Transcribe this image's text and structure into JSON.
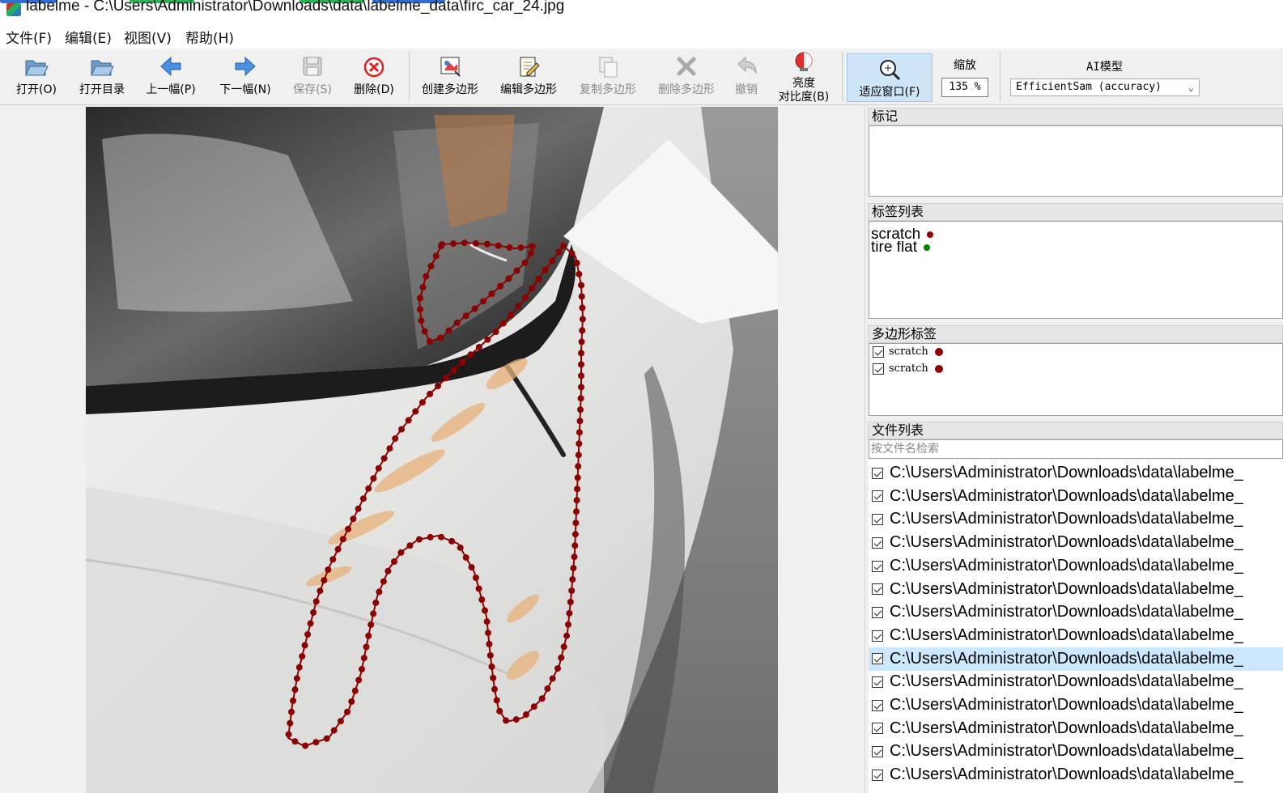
{
  "window": {
    "title": "labelme - C:\\Users\\Administrator\\Downloads\\data\\labelme_data\\firc_car_24.jpg"
  },
  "menu": [
    "文件(F)",
    "编辑(E)",
    "视图(V)",
    "帮助(H)"
  ],
  "toolbar": {
    "open": "打开(O)",
    "open_dir": "打开目录",
    "prev": "上一幅(P)",
    "next": "下一幅(N)",
    "save": "保存(S)",
    "delete": "删除(D)",
    "create_polygon": "创建多边形",
    "edit_polygon": "编辑多边形",
    "copy_polygon": "复制多边形",
    "delete_polygon": "删除多边形",
    "undo": "撤销",
    "brightness_line1": "亮度",
    "brightness_line2": "对比度(B)",
    "fit_window": "适应窗口(F)",
    "zoom_label": "缩放",
    "zoom_value": "135 %",
    "ai_label": "AI模型",
    "ai_model": "EfficientSam (accuracy)"
  },
  "docks": {
    "flags_title": "标记",
    "labels_title": "标签列表",
    "polygons_title": "多边形标签",
    "files_title": "文件列表",
    "file_search_placeholder": "按文件名检索"
  },
  "label_list": [
    {
      "name": "scratch",
      "color": "#8b0000"
    },
    {
      "name": "tire flat",
      "color": "#008000"
    }
  ],
  "polygon_labels": [
    {
      "name": "scratch",
      "color": "#8b0000",
      "checked": true
    },
    {
      "name": "scratch",
      "color": "#8b0000",
      "checked": true
    }
  ],
  "files": [
    {
      "path": "C:\\Users\\Administrator\\Downloads\\data\\labelme_",
      "checked": true,
      "selected": false
    },
    {
      "path": "C:\\Users\\Administrator\\Downloads\\data\\labelme_",
      "checked": true,
      "selected": false
    },
    {
      "path": "C:\\Users\\Administrator\\Downloads\\data\\labelme_",
      "checked": true,
      "selected": false
    },
    {
      "path": "C:\\Users\\Administrator\\Downloads\\data\\labelme_",
      "checked": true,
      "selected": false
    },
    {
      "path": "C:\\Users\\Administrator\\Downloads\\data\\labelme_",
      "checked": true,
      "selected": false
    },
    {
      "path": "C:\\Users\\Administrator\\Downloads\\data\\labelme_",
      "checked": true,
      "selected": false
    },
    {
      "path": "C:\\Users\\Administrator\\Downloads\\data\\labelme_",
      "checked": true,
      "selected": false
    },
    {
      "path": "C:\\Users\\Administrator\\Downloads\\data\\labelme_",
      "checked": true,
      "selected": false
    },
    {
      "path": "C:\\Users\\Administrator\\Downloads\\data\\labelme_",
      "checked": true,
      "selected": true
    },
    {
      "path": "C:\\Users\\Administrator\\Downloads\\data\\labelme_",
      "checked": true,
      "selected": false
    },
    {
      "path": "C:\\Users\\Administrator\\Downloads\\data\\labelme_",
      "checked": true,
      "selected": false
    },
    {
      "path": "C:\\Users\\Administrator\\Downloads\\data\\labelme_",
      "checked": true,
      "selected": false
    },
    {
      "path": "C:\\Users\\Administrator\\Downloads\\data\\labelme_",
      "checked": true,
      "selected": false
    },
    {
      "path": "C:\\Users\\Administrator\\Downloads\\data\\labelme_",
      "checked": true,
      "selected": false
    }
  ],
  "annotation_color": "#8b0000"
}
